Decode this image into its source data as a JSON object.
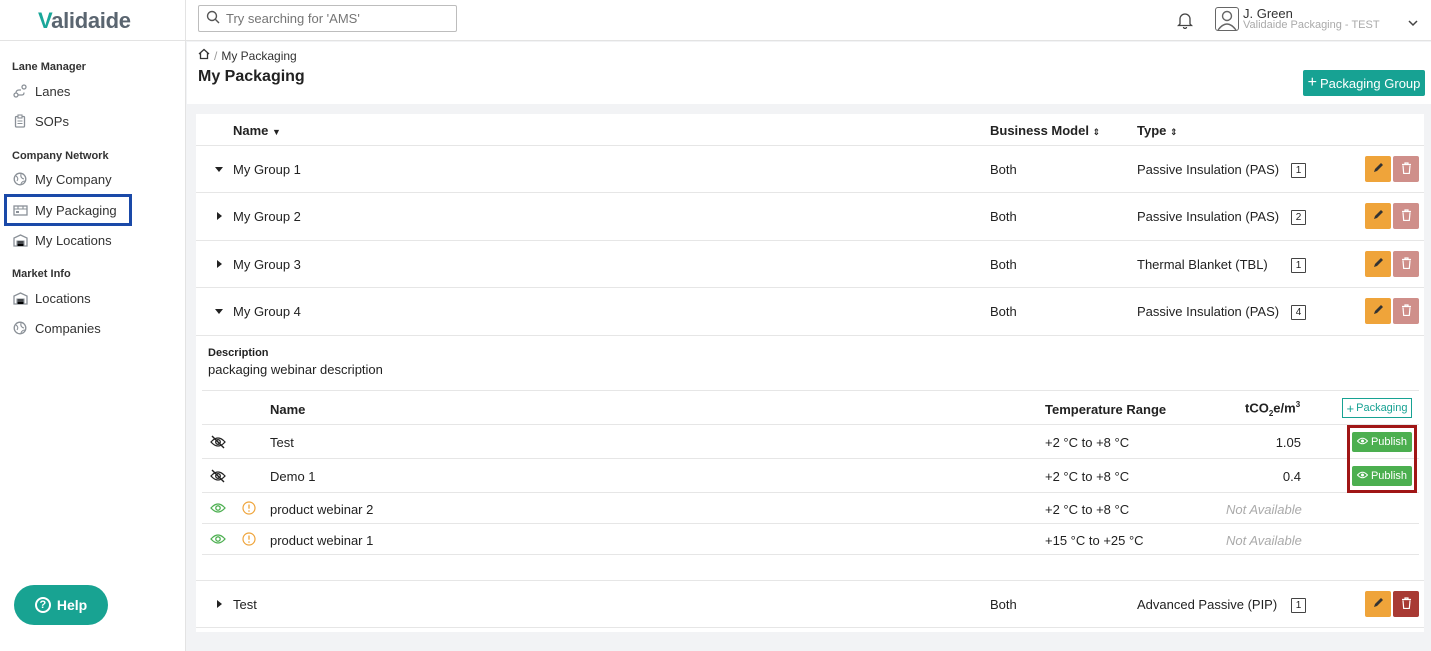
{
  "app": {
    "logo_initial": "V",
    "logo_rest": "alidaide"
  },
  "search": {
    "placeholder": "Try searching for 'AMS'"
  },
  "user": {
    "name": "J. Green",
    "org": "Validaide Packaging - TEST"
  },
  "sidebar": {
    "sections": [
      {
        "title": "Lane Manager",
        "items": [
          {
            "label": "Lanes",
            "icon": "lanes-icon"
          },
          {
            "label": "SOPs",
            "icon": "clipboard-icon"
          }
        ]
      },
      {
        "title": "Company Network",
        "items": [
          {
            "label": "My Company",
            "icon": "globe-icon"
          },
          {
            "label": "My Packaging",
            "icon": "packaging-icon",
            "active": true
          },
          {
            "label": "My Locations",
            "icon": "building-icon"
          }
        ]
      },
      {
        "title": "Market Info",
        "items": [
          {
            "label": "Locations",
            "icon": "building-icon"
          },
          {
            "label": "Companies",
            "icon": "globe-icon"
          }
        ]
      }
    ],
    "help_label": "Help"
  },
  "breadcrumb": {
    "current": "My Packaging",
    "separator": "/"
  },
  "page": {
    "title": "My Packaging",
    "add_group_label": "Packaging Group"
  },
  "table": {
    "headers": {
      "name": "Name",
      "business_model": "Business Model",
      "type": "Type"
    },
    "groups": [
      {
        "name": "My Group 1",
        "business_model": "Both",
        "type": "Passive Insulation (PAS)",
        "count": "1",
        "expanded": true
      },
      {
        "name": "My Group 2",
        "business_model": "Both",
        "type": "Passive Insulation (PAS)",
        "count": "2",
        "expanded": false
      },
      {
        "name": "My Group 3",
        "business_model": "Both",
        "type": "Thermal Blanket (TBL)",
        "count": "1",
        "expanded": false
      },
      {
        "name": "My Group 4",
        "business_model": "Both",
        "type": "Passive Insulation (PAS)",
        "count": "4",
        "expanded": true
      }
    ],
    "group4_detail": {
      "description_label": "Description",
      "description": "packaging webinar description",
      "sub_headers": {
        "name": "Name",
        "temp": "Temperature Range",
        "co2": "tCO",
        "co2_sub": "2",
        "co2_mid": "e/m",
        "co2_sup": "3"
      },
      "add_packaging_label": "Packaging",
      "items": [
        {
          "name": "Test",
          "temp": "+2 °C to +8 °C",
          "co2": "1.05",
          "published": false
        },
        {
          "name": "Demo 1",
          "temp": "+2 °C to +8 °C",
          "co2": "0.4",
          "published": false
        },
        {
          "name": "product webinar 2",
          "temp": "+2 °C to +8 °C",
          "co2": "Not Available",
          "published": true
        },
        {
          "name": "product webinar 1",
          "temp": "+15 °C to +25 °C",
          "co2": "Not Available",
          "published": true
        }
      ],
      "publish_label": "Publish"
    },
    "last_group": {
      "name": "Test",
      "business_model": "Both",
      "type": "Advanced Passive (PIP)",
      "count": "1"
    }
  },
  "colors": {
    "accent": "#17a293",
    "edit": "#efa43a",
    "delete": "#cf8f8a",
    "publish": "#4caf50",
    "highlight_blue": "#1a49a8",
    "highlight_red": "#a01616"
  }
}
